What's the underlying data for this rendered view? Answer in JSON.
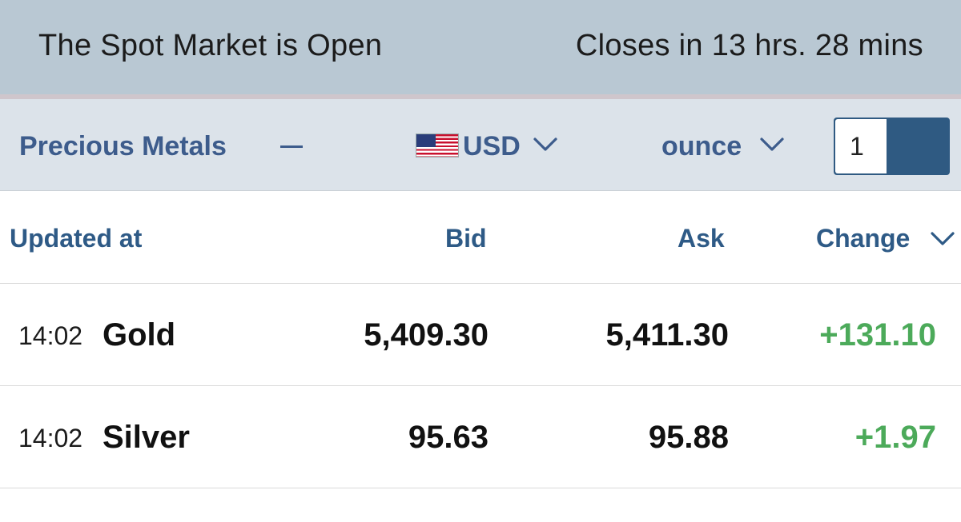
{
  "status": {
    "market_state": "The Spot Market is Open",
    "closes_in": "Closes in 13 hrs. 28 mins"
  },
  "toolbar": {
    "category": "Precious Metals",
    "currency": "USD",
    "currency_flag": "us-flag-icon",
    "unit": "ounce",
    "quantity": "1"
  },
  "table": {
    "headers": {
      "updated_at": "Updated at",
      "bid": "Bid",
      "ask": "Ask",
      "change": "Change"
    },
    "rows": [
      {
        "time": "14:02",
        "name": "Gold",
        "bid": "5,409.30",
        "ask": "5,411.30",
        "change": "+131.10"
      },
      {
        "time": "14:02",
        "name": "Silver",
        "bid": "95.63",
        "ask": "95.88",
        "change": "+1.97"
      }
    ]
  },
  "colors": {
    "header_blue": "#2e5a86",
    "positive_green": "#4caa5a",
    "status_bar_bg": "#b9c8d3",
    "toolbar_bg": "#dce3ea"
  }
}
